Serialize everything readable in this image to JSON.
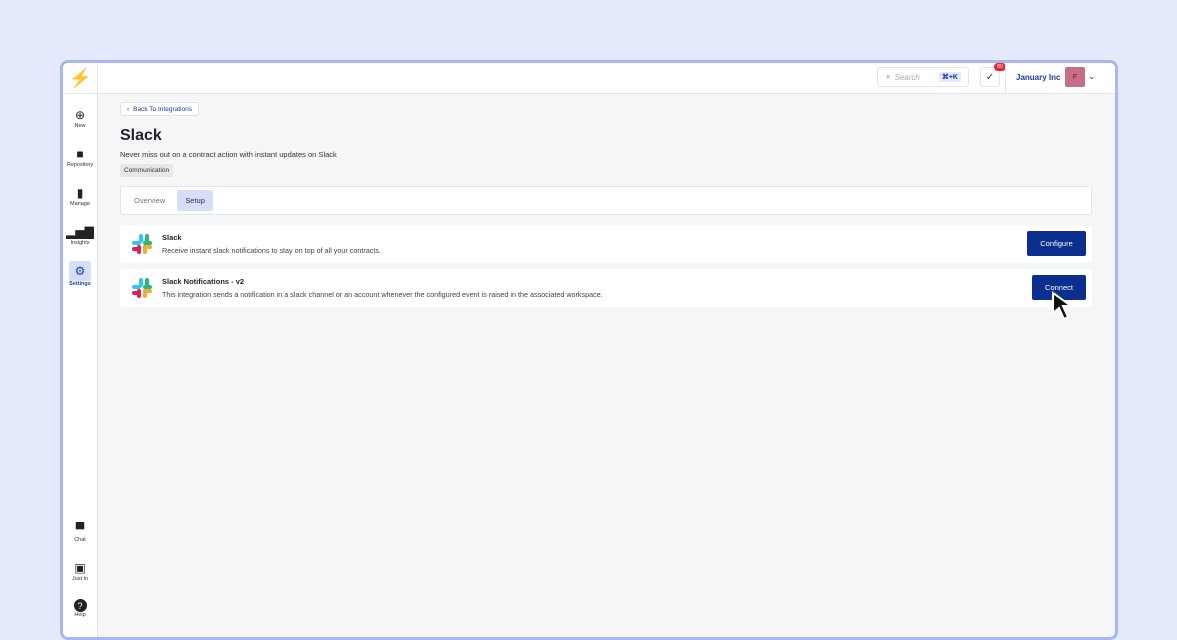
{
  "header": {
    "search_placeholder": "Search",
    "search_shortcut": "⌘+K",
    "notifications_count": "80",
    "org_name": "January Inc",
    "avatar_initial": "F"
  },
  "sidebar": {
    "items": [
      {
        "label": "New",
        "icon": "plus-circle-icon"
      },
      {
        "label": "Repository",
        "icon": "folder-icon"
      },
      {
        "label": "Manage",
        "icon": "document-gear-icon"
      },
      {
        "label": "Insights",
        "icon": "bar-chart-icon"
      },
      {
        "label": "Settings",
        "icon": "gear-icon",
        "active": true
      }
    ],
    "bottom_items": [
      {
        "label": "Chat",
        "icon": "chat-icon"
      },
      {
        "label": "Just In",
        "icon": "gift-icon"
      },
      {
        "label": "Help",
        "icon": "help-icon"
      }
    ]
  },
  "page": {
    "back_label": "Back To Integrations",
    "title": "Slack",
    "subtitle": "Never miss out on a contract action with instant updates on Slack",
    "tag": "Communication",
    "tabs": [
      {
        "label": "Overview"
      },
      {
        "label": "Setup",
        "active": true
      }
    ]
  },
  "integrations": [
    {
      "name": "Slack",
      "description": "Receive instant slack notifications to stay on top of all your contracts.",
      "action": "Configure"
    },
    {
      "name": "Slack Notifications - v2",
      "description": "This integration sends a notification in a slack channel or an account whenever the configured event is raised in the associated workspace.",
      "action": "Connect"
    }
  ]
}
